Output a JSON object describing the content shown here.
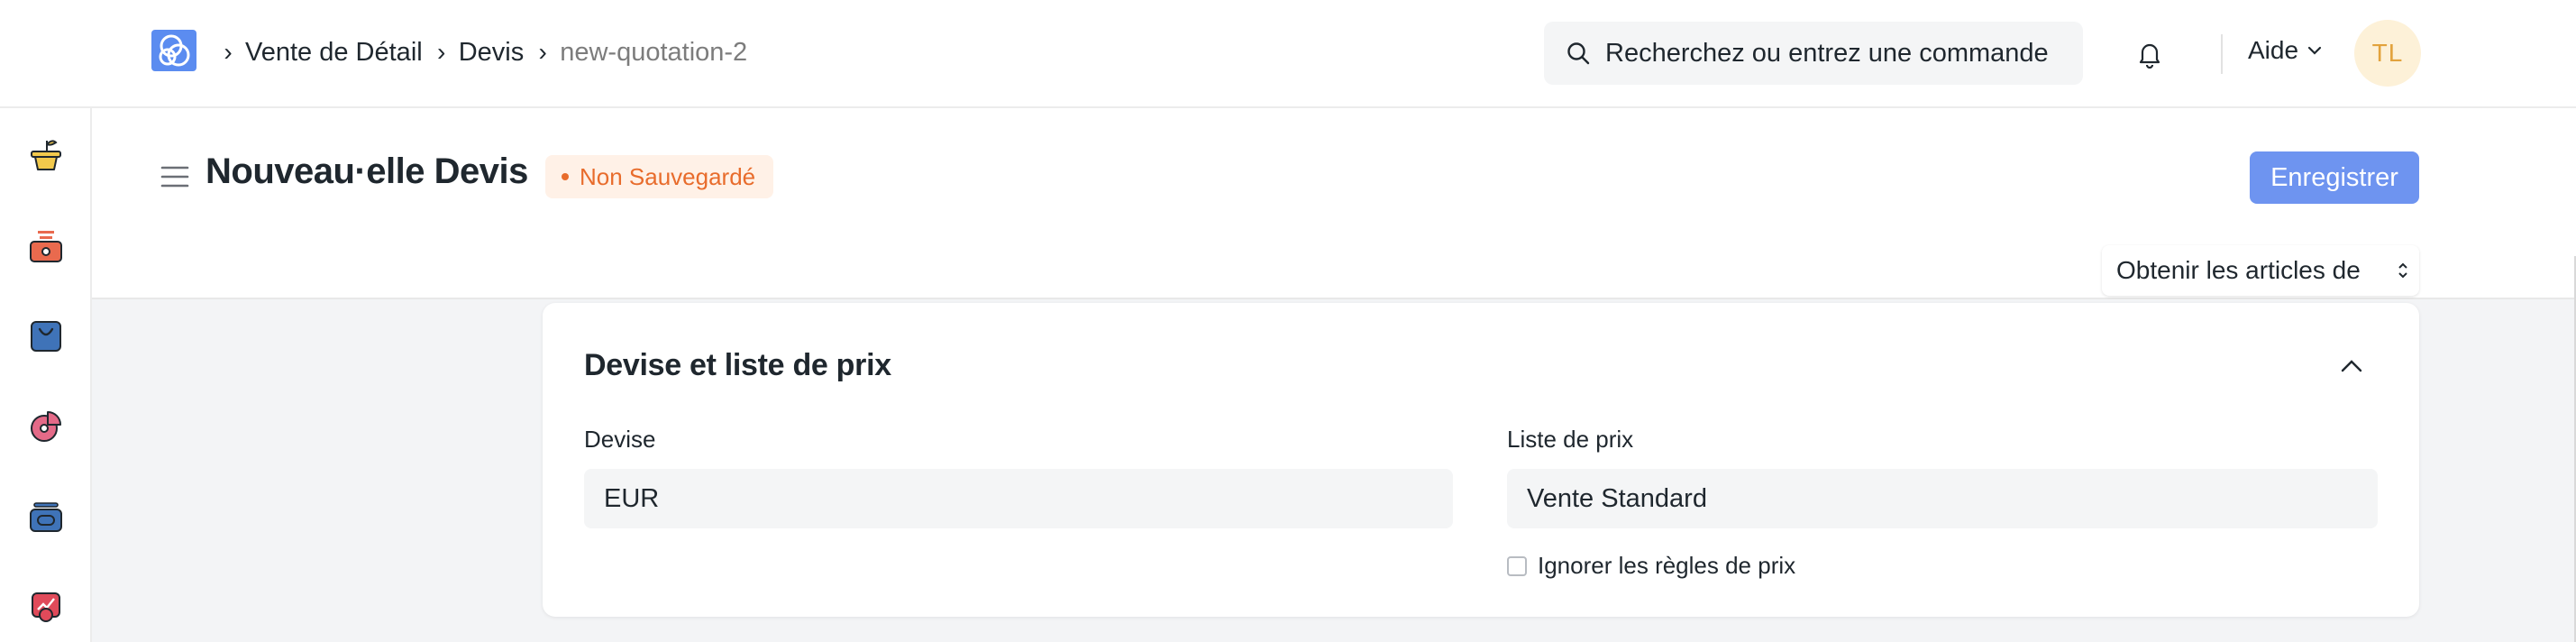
{
  "navbar": {
    "breadcrumb": [
      "Vente de Détail",
      "Devis",
      "new-quotation-2"
    ],
    "search_placeholder": "Recherchez ou entrez une commande",
    "help_label": "Aide",
    "user_initials": "TL"
  },
  "sidebar": {
    "items": [
      {
        "icon": "plant-pot-icon"
      },
      {
        "icon": "cash-register-icon"
      },
      {
        "icon": "shopping-bag-icon"
      },
      {
        "icon": "pie-chart-icon"
      },
      {
        "icon": "card-stack-icon"
      },
      {
        "icon": "chart-shield-icon"
      }
    ]
  },
  "page": {
    "title": "Nouveau·elle Devis",
    "status": "Non Sauvegardé",
    "save_label": "Enregistrer",
    "get_items_label": "Obtenir les articles de"
  },
  "section": {
    "title": "Devise et liste de prix",
    "currency_label": "Devise",
    "currency_value": "EUR",
    "price_list_label": "Liste de prix",
    "price_list_value": "Vente Standard",
    "ignore_pricing_label": "Ignorer les règles de prix",
    "ignore_pricing_checked": false
  },
  "colors": {
    "primary": "#6e94f0",
    "status_orange": "#e86c2c",
    "avatar_text": "#e2a23c"
  }
}
